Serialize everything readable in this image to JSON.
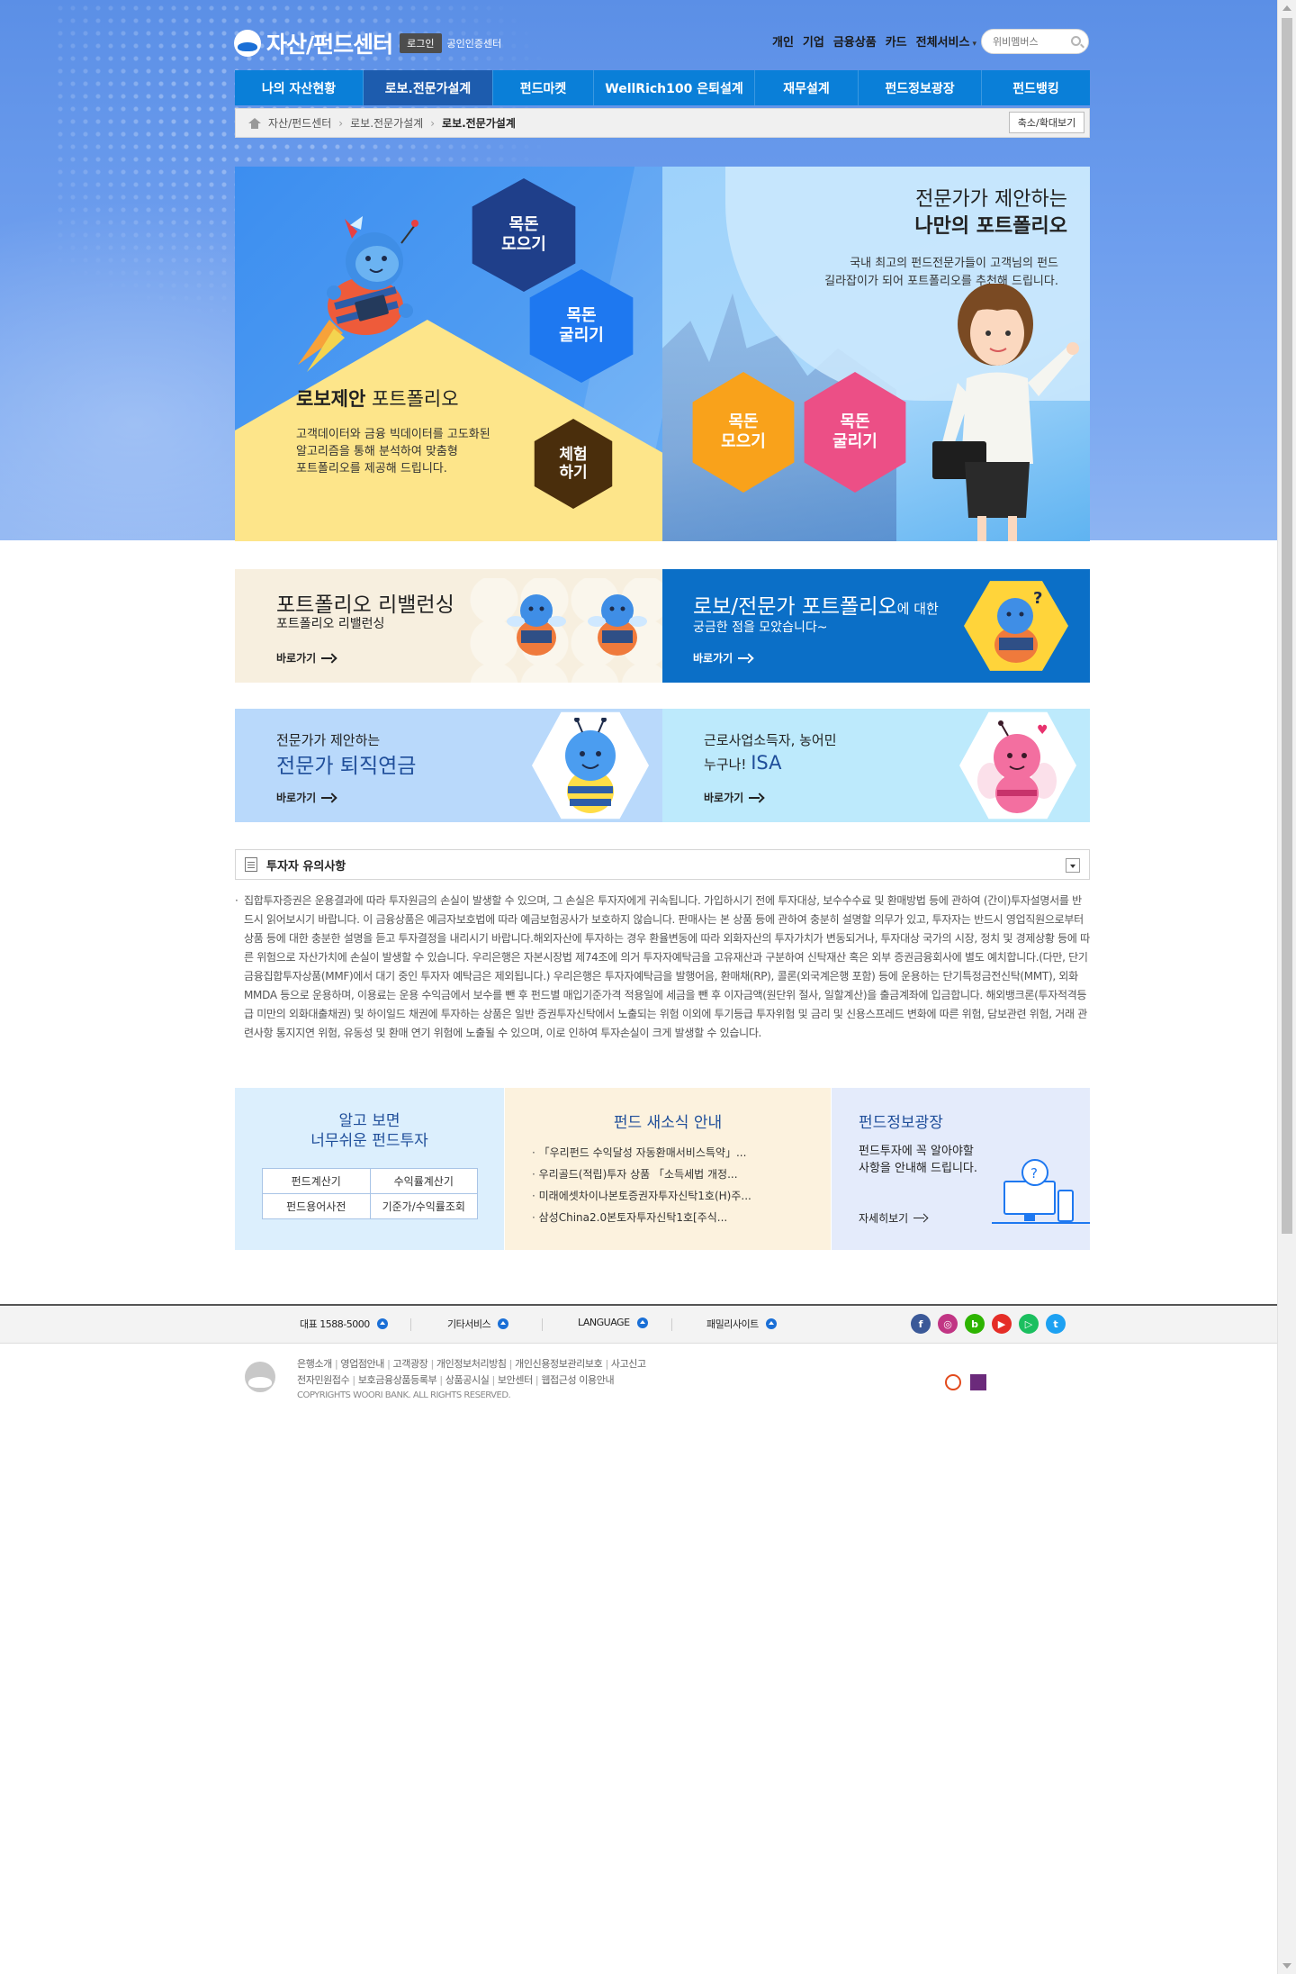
{
  "header": {
    "title": "자산/펀드센터",
    "login_label": "로그인",
    "cert_label": "공인인증센터",
    "util_nav": [
      "개인",
      "기업",
      "금융상품",
      "카드",
      "전체서비스"
    ],
    "search_placeholder": "위비멤버스"
  },
  "gnb": {
    "items": [
      "나의 자산현황",
      "로보.전문가설계",
      "펀드마켓",
      "WellRich100 은퇴설계",
      "재무설계",
      "펀드정보광장",
      "펀드뱅킹"
    ],
    "active_index": 1
  },
  "breadcrumb": {
    "items": [
      "자산/펀드센터",
      "로보.전문가설계",
      "로보.전문가설계"
    ],
    "zoom_label": "축소/확대보기"
  },
  "hero_left": {
    "hex_labels": [
      "목돈\n모으기",
      "목돈\n굴리기",
      "체험\n하기"
    ],
    "title_bold": "로보제안",
    "title_rest": " 포트폴리오",
    "desc": "고객데이터와 금융 빅데이터를 고도화된\n알고리즘을 통해 분석하여 맞춤형\n포트폴리오를 제공해 드립니다."
  },
  "hero_right": {
    "title_line1": "전문가가 제안하는",
    "title_line2": "나만의 포트폴리오",
    "desc": "국내 최고의 펀드전문가들이 고객님의 펀드\n길라잡이가 되어 포트폴리오를 추천해 드립니다.",
    "hex_labels": [
      "목돈\n모으기",
      "목돈\n굴리기"
    ]
  },
  "banners": {
    "rebalancing": {
      "title": "포트폴리오 리밸런싱",
      "subtitle": "포트폴리오 리밸런싱",
      "more": "바로가기"
    },
    "faq": {
      "title_big": "로보/전문가 포트폴리오",
      "title_small": "에 대한",
      "subtitle": "궁금한 점을 모았습니다~",
      "more": "바로가기"
    },
    "pension": {
      "subtitle": "전문가가 제안하는",
      "title": "전문가 퇴직연금",
      "more": "바로가기"
    },
    "isa": {
      "line1": "근로사업소득자, 농어민",
      "line2_prefix": "누구나! ",
      "line2_big": "ISA",
      "more": "바로가기"
    }
  },
  "notice": {
    "title": "투자자 유의사항",
    "body": "집합투자증권은 운용결과에 따라 투자원금의 손실이 발생할 수 있으며, 그 손실은 투자자에게 귀속됩니다. 가입하시기 전에 투자대상, 보수수수료 및 환매방법 등에 관하여 (간이)투자설명서를 반드시 읽어보시기 바랍니다. 이 금융상품은 예금자보호법에 따라 예금보험공사가 보호하지 않습니다. 판매사는 본 상품 등에 관하여 충분히 설명할 의무가 있고, 투자자는 반드시 영업직원으로부터 상품 등에 대한 충분한 설명을 듣고 투자결정을 내리시기 바랍니다.해외자산에 투자하는 경우 환율변동에 따라 외화자산의 투자가치가 변동되거나, 투자대상 국가의 시장, 정치 및 경제상황 등에 따른 위험으로 자산가치에 손실이 발생할 수 있습니다. 우리은행은 자본시장법 제74조에 의거 투자자예탁금을 고유재산과 구분하여 신탁재산 혹은 외부 증권금융회사에 별도 예치합니다.(다만, 단기금융집합투자상품(MMF)에서 대기 중인 투자자 예탁금은 제외됩니다.) 우리은행은 투자자예탁금을 발행어음, 환매채(RP), 콜론(외국계은행 포함) 등에 운용하는 단기특정금전신탁(MMT), 외화MMDA 등으로 운용하며, 이용료는 운용 수익금에서 보수를 뺀 후 펀드별 매입기준가격 적용일에 세금을 뺀 후 이자금액(원단위 절사, 일할계산)을 출금계좌에 입금합니다. 해외뱅크론(투자적격등급 미만의 외화대출채권) 및 하이일드 채권에 투자하는 상품은 일반 증권투자신탁에서 노출되는 위험 이외에 투기등급 투자위험 및 금리 및 신용스프레드 변화에 따른 위험, 담보관련 위험, 거래 관련사항 통지지연 위험, 유동성 및 환매 연기 위험에 노출될 수 있으며, 이로 인하여 투자손실이 크게 발생할 수 있습니다."
  },
  "info_boxes": {
    "easy": {
      "title_line1": "알고 보면",
      "title_line2": "너무쉬운 펀드투자",
      "links": [
        "펀드계산기",
        "수익률계산기",
        "펀드용어사전",
        "기준가/수익률조회"
      ]
    },
    "news": {
      "title": "펀드 새소식 안내",
      "items": [
        "「우리펀드 수익달성 자동환매서비스특약」...",
        "우리골드(적립)투자 상품 「소득세법 개정...",
        "미래에셋차이나본토증권자투자신탁1호(H)주...",
        "삼성China2.0본토자투자신탁1호[주식..."
      ]
    },
    "square": {
      "title": "펀드정보광장",
      "desc": "펀드투자에 꼭 알아야할\n사항을 안내해 드립니다.",
      "more": "자세히보기"
    }
  },
  "footer": {
    "top": [
      "대표 1588-5000",
      "기타서비스",
      "LANGUAGE",
      "패밀리사이트"
    ],
    "social": [
      {
        "name": "facebook-icon",
        "label": "f",
        "color": "#3b5998"
      },
      {
        "name": "instagram-icon",
        "label": "◎",
        "color": "#c13584"
      },
      {
        "name": "blog-icon",
        "label": "b",
        "color": "#2db400"
      },
      {
        "name": "youtube-icon",
        "label": "▶",
        "color": "#e52d27"
      },
      {
        "name": "kakaostory-icon",
        "label": "▷",
        "color": "#1bbf5f"
      },
      {
        "name": "twitter-icon",
        "label": "t",
        "color": "#1da1f2"
      }
    ],
    "links_row1": [
      "은행소개",
      "영업점안내",
      "고객광장",
      "개인정보처리방침",
      "개인신용정보관리보호",
      "사고신고"
    ],
    "links_row2": [
      "전자민원접수",
      "보호금융상품등록부",
      "상품공시실",
      "보안센터",
      "웹접근성 이용안내"
    ],
    "copyright": "COPYRIGHTS WOORI BANK. ALL RIGHTS RESERVED."
  },
  "colors": {
    "gnb": "#0a7fd8",
    "gnb_active": "#1d5cae",
    "hex_navy": "#1f3f8a",
    "hex_blue": "#1e78f0",
    "hex_brown": "#4a2e0c",
    "hex_orange": "#f9a21b",
    "hex_pink": "#ec4f86",
    "banner_faq": "#0b6fc7"
  }
}
